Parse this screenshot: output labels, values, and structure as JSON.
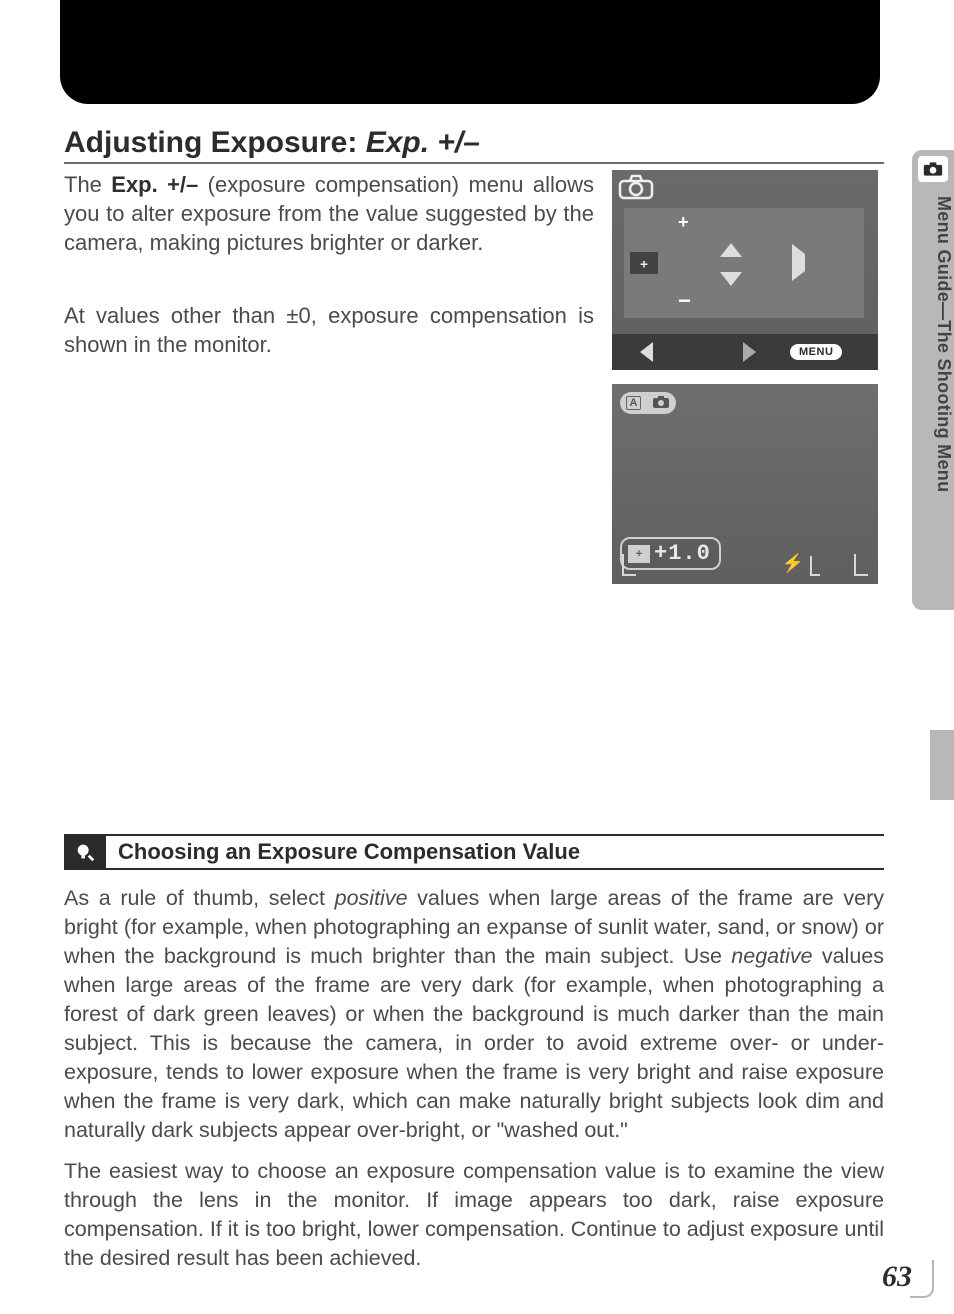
{
  "header": {
    "title_plain": "Adjusting Exposure: ",
    "title_em": "Exp. +/–"
  },
  "body": {
    "p1": "The Exp. +/– (exposure compensation) menu allows you to alter exposure from the value suggested by the camera, making pictures brighter or darker.",
    "p2": "At values other than ±0, exposure compensation is shown in the monitor."
  },
  "fig1": {
    "plus": "+",
    "minus": "−",
    "menu_label": "MENU",
    "ec_glyph": "⧾"
  },
  "fig2": {
    "mode_letter": "A",
    "ev_icon": "⧾",
    "ev_value": "+1.0",
    "flash_icon": "⚡"
  },
  "tip": {
    "title": "Choosing an Exposure Compensation Value",
    "p1": "As a rule of thumb, select positive values when large areas of the frame are very bright (for example, when photographing an expanse of sunlit water, sand, or snow) or when the background is much brighter than the main subject.  Use negative values when large areas of the frame are very dark (for example, when photographing a forest of dark green leaves) or when the background is much darker than the main subject.  This is because the camera, in order to avoid extreme over- or under-exposure, tends to lower exposure when the frame is very bright and raise exposure when the frame is very dark, which can make naturally bright subjects look dim and naturally dark subjects appear over-bright, or \"washed out.\"",
    "p2": "The easiest way to choose an exposure compensation value is to examine the view through the lens in the monitor.  If image appears too dark, raise exposure compensation.  If it is too bright, lower compensation.  Continue to adjust exposure until the desired result has been achieved."
  },
  "side": {
    "label": "Menu Guide—The Shooting Menu"
  },
  "page": {
    "number": "63"
  }
}
